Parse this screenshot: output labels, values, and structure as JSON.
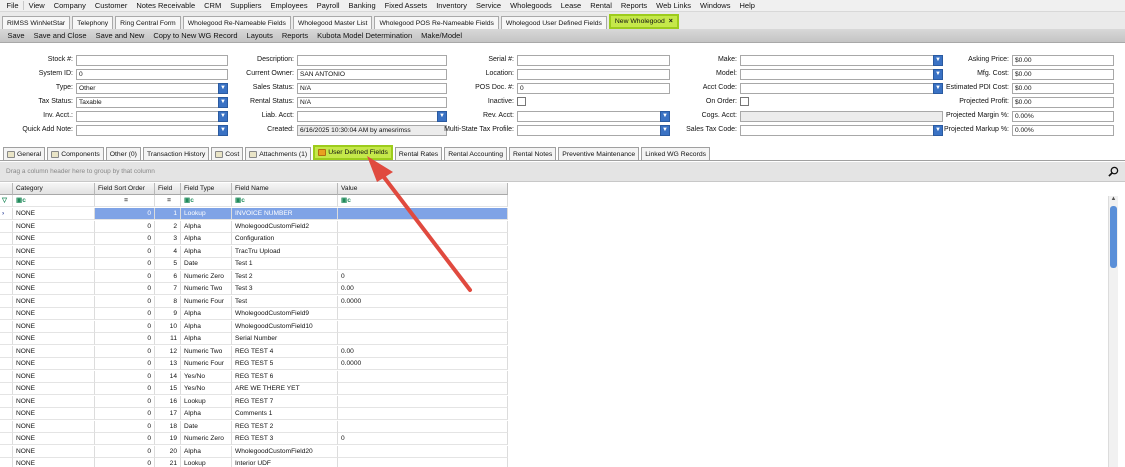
{
  "menu": [
    "File",
    "View",
    "Company",
    "Customer",
    "Notes Receivable",
    "CRM",
    "Suppliers",
    "Employees",
    "Payroll",
    "Banking",
    "Fixed Assets",
    "Inventory",
    "Service",
    "Wholegoods",
    "Lease",
    "Rental",
    "Reports",
    "Web Links",
    "Windows",
    "Help"
  ],
  "window_tabs": [
    {
      "label": "RIMSS WinNetStar"
    },
    {
      "label": "Telephony"
    },
    {
      "label": "Ring Central Form"
    },
    {
      "label": "Wholegood Re-Nameable Fields"
    },
    {
      "label": "Wholegood Master List"
    },
    {
      "label": "Wholegood POS Re-Nameable Fields"
    },
    {
      "label": "Wholegood User Defined Fields"
    },
    {
      "label": "New Wholegood",
      "active": true
    }
  ],
  "window_tab_close": "×",
  "toolbar": [
    "Save",
    "Save and Close",
    "Save and New",
    "Copy to New WG Record",
    "Layouts",
    "Reports",
    "Kubota Model Determination",
    "Make/Model"
  ],
  "form": {
    "stock_label": "Stock #:",
    "stock_value": "",
    "system_id_label": "System ID:",
    "system_id_value": "0",
    "type_label": "Type:",
    "type_value": "Other",
    "tax_status_label": "Tax Status:",
    "tax_status_value": "Taxable",
    "inv_acct_label": "Inv. Acct.:",
    "inv_acct_value": "",
    "quick_add_note_label": "Quick Add Note:",
    "quick_add_note_value": "",
    "description_label": "Description:",
    "description_value": "",
    "current_owner_label": "Current Owner:",
    "current_owner_value": "SAN ANTONIO",
    "sales_status_label": "Sales Status:",
    "sales_status_value": "N/A",
    "rental_status_label": "Rental Status:",
    "rental_status_value": "N/A",
    "liab_acct_label": "Liab. Acct:",
    "liab_acct_value": "",
    "created_label": "Created:",
    "created_value": "6/16/2025 10:30:04 AM by amesrimss",
    "serial_label": "Serial #:",
    "serial_value": "",
    "location_label": "Location:",
    "location_value": "",
    "pos_doc_label": "POS Doc. #:",
    "pos_doc_value": "0",
    "inactive_label": "Inactive:",
    "rev_acct_label": "Rev. Acct:",
    "rev_acct_value": "",
    "multi_state_label": "Multi-State Tax Profile:",
    "multi_state_value": "",
    "make_label": "Make:",
    "make_value": "",
    "model_label": "Model:",
    "model_value": "",
    "acct_code_label": "Acct Code:",
    "acct_code_value": "",
    "on_order_label": "On Order:",
    "cogs_acct_label": "Cogs. Acct:",
    "cogs_acct_value": "",
    "sales_tax_code_label": "Sales Tax Code:",
    "sales_tax_code_value": "",
    "asking_price_label": "Asking Price:",
    "asking_price_value": "$0.00",
    "mfg_cost_label": "Mfg. Cost:",
    "mfg_cost_value": "$0.00",
    "est_pdi_label": "Estimated PDI Cost:",
    "est_pdi_value": "$0.00",
    "proj_profit_label": "Projected Profit:",
    "proj_profit_value": "$0.00",
    "proj_margin_label": "Projected Margin %:",
    "proj_margin_value": "0.00%",
    "proj_markup_label": "Projected Markup %:",
    "proj_markup_value": "0.00%"
  },
  "form_tabs": [
    {
      "label": "General",
      "icon": true
    },
    {
      "label": "Components",
      "icon": true
    },
    {
      "label": "Other (0)",
      "icon": false
    },
    {
      "label": "Transaction History",
      "icon": false
    },
    {
      "label": "Cost",
      "icon": true
    },
    {
      "label": "Attachments (1)",
      "icon": true
    },
    {
      "label": "User Defined Fields",
      "icon": true,
      "active": true
    },
    {
      "label": "Rental Rates",
      "icon": false
    },
    {
      "label": "Rental Accounting",
      "icon": false
    },
    {
      "label": "Rental Notes",
      "icon": false
    },
    {
      "label": "Preventive Maintenance",
      "icon": false
    },
    {
      "label": "Linked WG Records",
      "icon": false
    }
  ],
  "group_hint": "Drag a column header here to group by that column",
  "grid": {
    "columns": [
      "Category",
      "Field Sort Order",
      "Field",
      "Field Type",
      "Field Name",
      "Value"
    ],
    "filter_row": [
      "",
      "=",
      "=",
      "",
      "",
      ""
    ],
    "rows": [
      [
        "NONE",
        "0",
        "1",
        "Lookup",
        "INVOICE NUMBER",
        ""
      ],
      [
        "NONE",
        "0",
        "2",
        "Alpha",
        "WholegoodCustomField2",
        ""
      ],
      [
        "NONE",
        "0",
        "3",
        "Alpha",
        "Configuration",
        ""
      ],
      [
        "NONE",
        "0",
        "4",
        "Alpha",
        "TracTru Upload",
        ""
      ],
      [
        "NONE",
        "0",
        "5",
        "Date",
        "Test 1",
        ""
      ],
      [
        "NONE",
        "0",
        "6",
        "Numeric Zero",
        "Test 2",
        "0"
      ],
      [
        "NONE",
        "0",
        "7",
        "Numeric Two",
        "Test 3",
        "0.00"
      ],
      [
        "NONE",
        "0",
        "8",
        "Numeric Four",
        "Test",
        "0.0000"
      ],
      [
        "NONE",
        "0",
        "9",
        "Alpha",
        "WholegoodCustomField9",
        ""
      ],
      [
        "NONE",
        "0",
        "10",
        "Alpha",
        "WholegoodCustomField10",
        ""
      ],
      [
        "NONE",
        "0",
        "11",
        "Alpha",
        "Serial Number",
        ""
      ],
      [
        "NONE",
        "0",
        "12",
        "Numeric Two",
        "REG TEST 4",
        "0.00"
      ],
      [
        "NONE",
        "0",
        "13",
        "Numeric Four",
        "REG TEST 5",
        "0.0000"
      ],
      [
        "NONE",
        "0",
        "14",
        "Yes/No",
        "REG TEST 6",
        ""
      ],
      [
        "NONE",
        "0",
        "15",
        "Yes/No",
        "ARE WE THERE YET",
        ""
      ],
      [
        "NONE",
        "0",
        "16",
        "Lookup",
        "REG TEST 7",
        ""
      ],
      [
        "NONE",
        "0",
        "17",
        "Alpha",
        "Comments 1",
        ""
      ],
      [
        "NONE",
        "0",
        "18",
        "Date",
        "REG TEST 2",
        ""
      ],
      [
        "NONE",
        "0",
        "19",
        "Numeric Zero",
        "REG TEST 3",
        "0"
      ],
      [
        "NONE",
        "0",
        "20",
        "Alpha",
        "WholegoodCustomField20",
        ""
      ],
      [
        "NONE",
        "0",
        "21",
        "Lookup",
        "Interior UDF",
        ""
      ]
    ]
  },
  "colors": {
    "highlight": "#c5e84a",
    "selection": "#7fa3e6",
    "annotation_arrow": "#e04a3f"
  }
}
